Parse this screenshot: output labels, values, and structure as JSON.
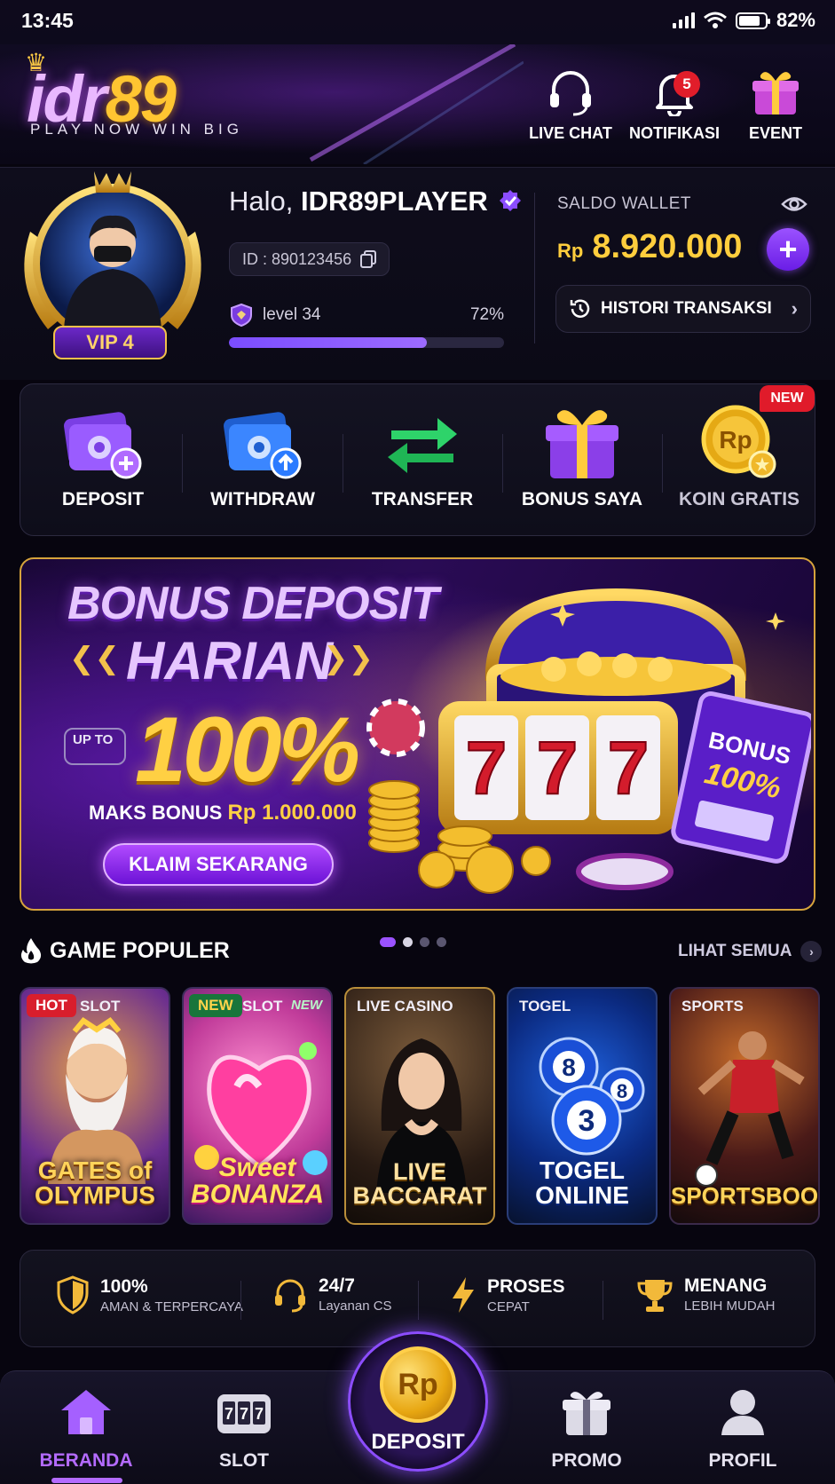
{
  "status_bar": {
    "time": "13:45",
    "battery": "82%"
  },
  "header": {
    "logo_part1": "idr",
    "logo_part2": "89",
    "tagline": "PLAY NOW WIN BIG",
    "live_chat": "LIVE CHAT",
    "notifikasi": "NOTIFIKASI",
    "notif_count": "5",
    "event": "EVENT"
  },
  "profile": {
    "greeting": "Halo,",
    "username": "IDR89PLAYER",
    "id_text": "ID : 890123456",
    "vip": "VIP 4",
    "level": "level 34",
    "level_percent_text": "72%",
    "level_progress": 0.72,
    "wallet_label": "SALDO WALLET",
    "currency": "Rp",
    "balance": "8.920.000",
    "history": "HISTORI TRANSAKSI"
  },
  "actions": [
    {
      "label": "DEPOSIT"
    },
    {
      "label": "WITHDRAW"
    },
    {
      "label": "TRANSFER"
    },
    {
      "label": "BONUS SAYA"
    },
    {
      "label": "KOIN GRATIS"
    }
  ],
  "new_badge": "NEW",
  "banner": {
    "title1": "BONUS DEPOSIT",
    "title2": "HARIAN",
    "upto": "UP TO",
    "percent": "100%",
    "max_label": "MAKS BONUS",
    "max_value": "Rp 1.000.000",
    "cta": "KLAIM SEKARANG",
    "ticket_text": "BONUS",
    "ticket_percent": "100%",
    "reel_symbol": "7"
  },
  "games_section": {
    "title": "GAME POPULER",
    "see_all": "LIHAT SEMUA"
  },
  "games": [
    {
      "chip": "HOT",
      "category": "SLOT",
      "title": "GATES of OLYMPUS"
    },
    {
      "chip": "NEW",
      "category": "SLOT",
      "corner": "NEW",
      "title": "Sweet BONANZA"
    },
    {
      "category": "LIVE CASINO",
      "title": "LIVE BACCARAT"
    },
    {
      "category": "TOGEL",
      "title": "TOGEL ONLINE",
      "balls": [
        "8",
        "3",
        "8"
      ]
    },
    {
      "category": "SPORTS",
      "title": "SPORTSBOOK"
    }
  ],
  "features": [
    {
      "title": "100%",
      "subtitle": "AMAN & TERPERCAYA"
    },
    {
      "title": "24/7",
      "subtitle": "Layanan CS"
    },
    {
      "title": "PROSES",
      "subtitle": "CEPAT"
    },
    {
      "title": "MENANG",
      "subtitle": "LEBIH MUDAH"
    }
  ],
  "nav": {
    "beranda": "BERANDA",
    "slot": "SLOT",
    "deposit": "DEPOSIT",
    "deposit_coin": "Rp",
    "promo": "PROMO",
    "profil": "PROFIL"
  },
  "colors": {
    "accent_purple": "#9b52ff",
    "gold": "#ffce3d",
    "badge_red": "#e11d2a"
  }
}
